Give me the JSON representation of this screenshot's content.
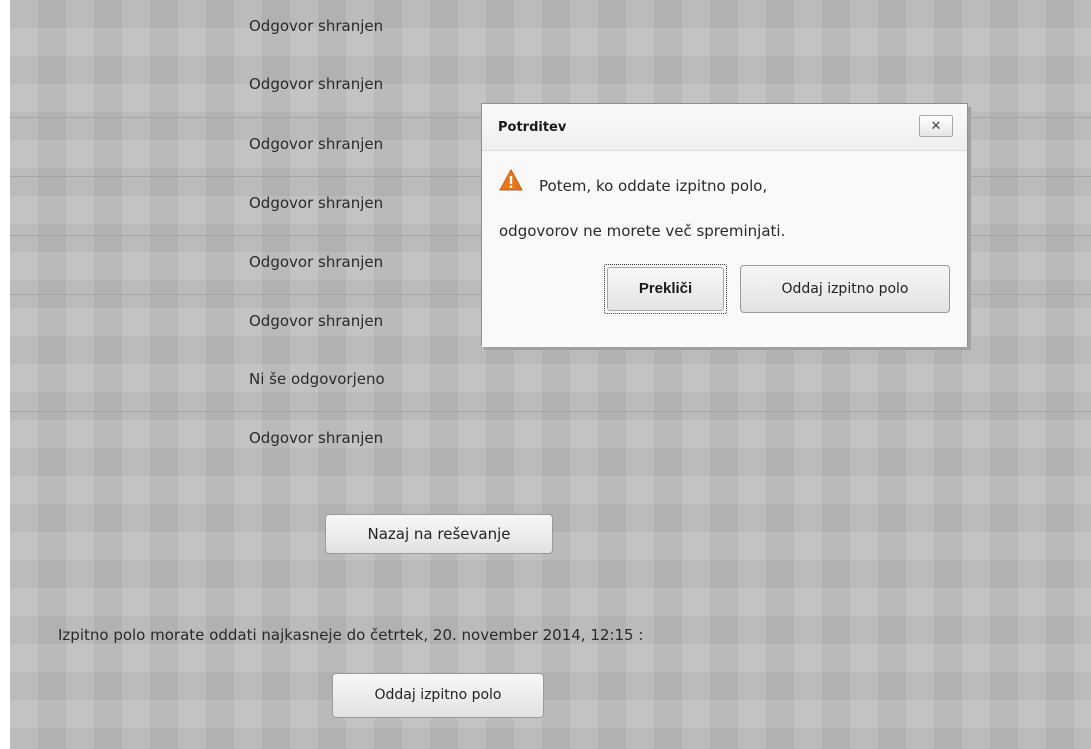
{
  "rows": [
    {
      "status": "Odgovor shranjen"
    },
    {
      "status": "Odgovor shranjen"
    },
    {
      "status": "Odgovor shranjen"
    },
    {
      "status": "Odgovor shranjen"
    },
    {
      "status": "Odgovor shranjen"
    },
    {
      "status": "Odgovor shranjen"
    },
    {
      "status": "Ni še odgovorjeno"
    },
    {
      "status": "Odgovor shranjen"
    }
  ],
  "back_button_label": "Nazaj na reševanje",
  "deadline_text": "Izpitno polo morate oddati najkasneje do četrtek, 20. november 2014, 12:15 :",
  "submit_button_label": "Oddaj izpitno polo",
  "dialog": {
    "title": "Potrditev",
    "close_label": "✕",
    "message_line1": "Potem, ko oddate izpitno polo,",
    "message_line2": "odgovorov ne morete več spreminjati.",
    "cancel_label": "Prekliči",
    "confirm_label": "Oddaj izpitno polo",
    "icon": "warning-icon",
    "warning_color": "#e8761c"
  }
}
